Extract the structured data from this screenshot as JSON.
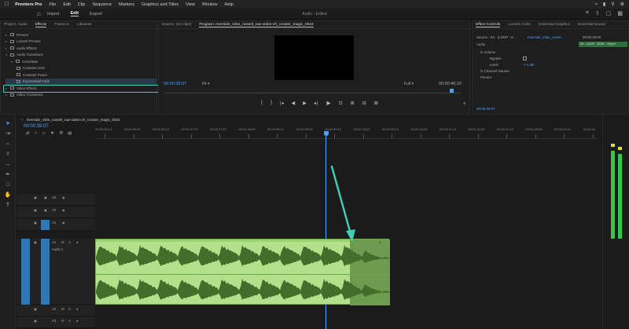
{
  "menubar": {
    "apple_icon": "apple-icon",
    "app": "Premiere Pro",
    "items": [
      "File",
      "Edit",
      "Clip",
      "Sequence",
      "Markers",
      "Graphics and Titles",
      "View",
      "Window",
      "Help"
    ]
  },
  "workspace": {
    "tabs": [
      "Import",
      "Edit",
      "Export"
    ],
    "active": "Edit",
    "center_title": "Audio - Edited"
  },
  "project_panel": {
    "tabs": [
      "Project: Audio",
      "Effects",
      "Frame.io",
      "Libraries"
    ],
    "active_tab": "Effects",
    "tree": [
      {
        "label": "Presets",
        "indent": 0
      },
      {
        "label": "Lumetri Presets",
        "indent": 0
      },
      {
        "label": "Audio Effects",
        "indent": 0
      },
      {
        "label": "Audio Transitions",
        "indent": 0
      },
      {
        "label": "Crossfade",
        "indent": 1
      },
      {
        "label": "Constant Gain",
        "indent": 2
      },
      {
        "label": "Constant Power",
        "indent": 2
      },
      {
        "label": "Exponential Fade",
        "indent": 2,
        "selected": true
      },
      {
        "label": "Video Effects",
        "indent": 0
      },
      {
        "label": "Video Transitions",
        "indent": 0
      }
    ]
  },
  "program_monitor": {
    "tabs": [
      "Source: (no clips)",
      "Program: riverside_mike_russell_raw-video-cfr_creator_magic_0024"
    ],
    "active_tab": "Program: riverside_mike_russell_raw-video-cfr_creator_magic_0024",
    "current_time": "00:00:39:07",
    "fit": "Fit",
    "resolution": "Full",
    "duration": "00:00:40:10",
    "transport": [
      "{",
      "}",
      "|◂",
      "◂|",
      "◀",
      "▶",
      "|▶",
      "▸|",
      "⊡",
      "⊞",
      "⊟",
      "⊠",
      "📷",
      "⬚"
    ]
  },
  "effect_controls": {
    "tabs": [
      "Effect Controls",
      "Lumetri Color",
      "Essential Graphics",
      "Essential Sound"
    ],
    "active_tab": "Effect Controls",
    "source": "Source - 04 - (LOOP - E...",
    "clip": "riverside_mike_russel...",
    "time": "00:00:30:00",
    "section": "Audio",
    "green_clip": "04 - LOOP - EDM - 74bpm",
    "rows": [
      {
        "label": "fx  Volume",
        "y": 37
      },
      {
        "label": "Bypass",
        "y": 45
      },
      {
        "label": "Level",
        "y": 53
      },
      {
        "label": "fx  Channel Volume",
        "y": 61
      },
      {
        "label": "Panner",
        "y": 69
      }
    ],
    "level_value": "-7.4 dB",
    "bottom_time": "00:00:39:07"
  },
  "timeline": {
    "sequence_title": "riverside_mike_russell_raw-video-cfr_creator_magic_0024",
    "current_time": "00:00:39:07",
    "ruler": [
      "00:00:35:12",
      "00:00:36:00",
      "00:00:36:12",
      "00:00:37:00",
      "00:00:37:12",
      "00:00:38:00",
      "00:00:38:12",
      "00:00:39:00",
      "00:00:39:12",
      "00:00:40:00",
      "00:00:40:12",
      "00:00:41:00",
      "00:00:41:12",
      "00:00:42:00",
      "00:00:42:12",
      "00:00:43:00",
      "00:00:43:12",
      "00:00:44"
    ],
    "video_tracks": [
      "V3",
      "V2",
      "V1"
    ],
    "audio_tracks": [
      "A1",
      "A2",
      "A3"
    ],
    "audio_track_name": "Audio 1",
    "track_buttons": [
      "M",
      "S"
    ],
    "clip_label": "fx"
  },
  "colors": {
    "accent": "#4aa3ff",
    "highlight": "#3ed0b6",
    "audio_clip": "#b3e08a",
    "audio_clip_dark": "#6d9b50",
    "meter": "#31c94a"
  }
}
